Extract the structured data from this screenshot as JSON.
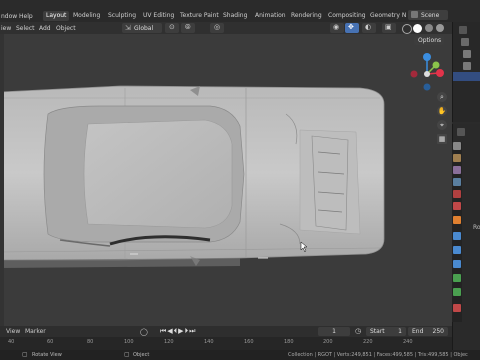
{
  "topbar": {
    "menus": [
      "ndow",
      "Help"
    ],
    "workspace_tabs": [
      "Layout",
      "Modeling",
      "Sculpting",
      "UV Editing",
      "Texture Paint",
      "Shading",
      "Animation",
      "Rendering",
      "Compositing",
      "Geometry N"
    ],
    "active_tab": "Layout",
    "scene": "Scene"
  },
  "viewport_header": {
    "menus": [
      "iew",
      "Select",
      "Add",
      "Object"
    ],
    "orientation": "Global",
    "options": "Options"
  },
  "gizmo": {
    "axes": [
      "Z",
      "Y",
      "X"
    ],
    "colors": {
      "x": "#e2334a",
      "y": "#8bc34a",
      "z": "#3b8ee0"
    }
  },
  "timeline": {
    "menus": [
      "View",
      "Marker"
    ],
    "current_frame": "1",
    "start_label": "Start",
    "start": "1",
    "end_label": "End",
    "end": "250",
    "ticks": [
      "40",
      "60",
      "80",
      "100",
      "120",
      "140",
      "160",
      "180",
      "200",
      "220",
      "240"
    ]
  },
  "statusbar": {
    "left": "Rotate View",
    "middle": "Object",
    "right": "Collection | RGOT | Verts:249,851 | Faces:499,585 | Tris:499,585 | Objec"
  },
  "properties": {
    "label": "Ro"
  }
}
